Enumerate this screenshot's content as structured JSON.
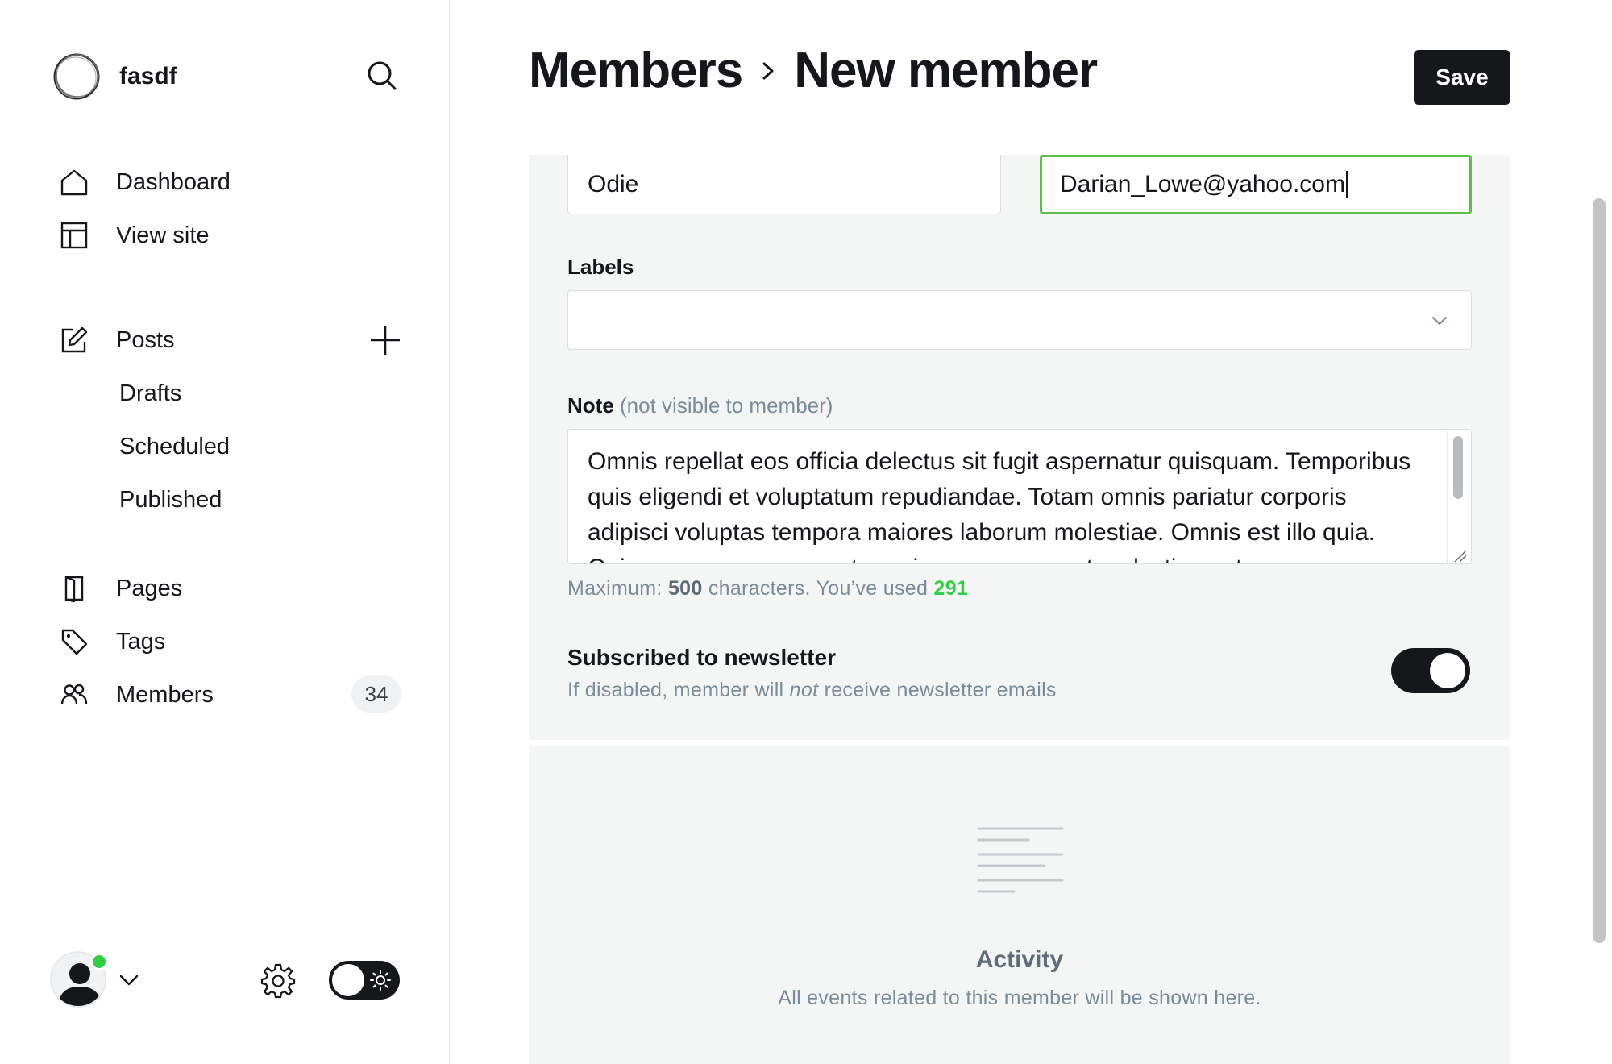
{
  "site": {
    "name": "fasdf"
  },
  "nav": {
    "dashboard": "Dashboard",
    "view_site": "View site",
    "posts": "Posts",
    "drafts": "Drafts",
    "scheduled": "Scheduled",
    "published": "Published",
    "pages": "Pages",
    "tags": "Tags",
    "members": "Members",
    "members_count": "34"
  },
  "header": {
    "breadcrumb_parent": "Members",
    "breadcrumb_current": "New member",
    "save_label": "Save"
  },
  "form": {
    "name_value": "Odie",
    "email_value": "Darian_Lowe@yahoo.com",
    "labels_label": "Labels",
    "note_label": "Note",
    "note_hint": "(not visible to member)",
    "note_value": "Omnis repellat eos officia delectus sit fugit aspernatur quisquam. Temporibus quis eligendi et voluptatum repudiandae. Totam omnis pariatur corporis adipisci voluptas tempora maiores laborum molestiae. Omnis est illo quia. Quia magnam consequatur quis neque quaerat molestias aut non.",
    "char_hint_prefix": "Maximum:",
    "char_max": "500",
    "char_hint_mid": "characters. You’ve used",
    "char_used": "291",
    "newsletter_title": "Subscribed to newsletter",
    "newsletter_desc_before": "If disabled, member will",
    "newsletter_desc_em": "not",
    "newsletter_desc_after": "receive newsletter emails",
    "newsletter_enabled": true
  },
  "activity": {
    "title": "Activity",
    "description": "All events related to this member will be shown here."
  },
  "colors": {
    "accent_green": "#30cf43",
    "focus_border": "#5cc04b",
    "dark": "#15171a"
  },
  "icons": [
    "search-icon",
    "home-icon",
    "layout-icon",
    "edit-icon",
    "plus-icon",
    "pages-icon",
    "tag-icon",
    "members-icon",
    "chevron-right-icon",
    "chevron-down-icon",
    "gear-icon",
    "sun-icon"
  ]
}
